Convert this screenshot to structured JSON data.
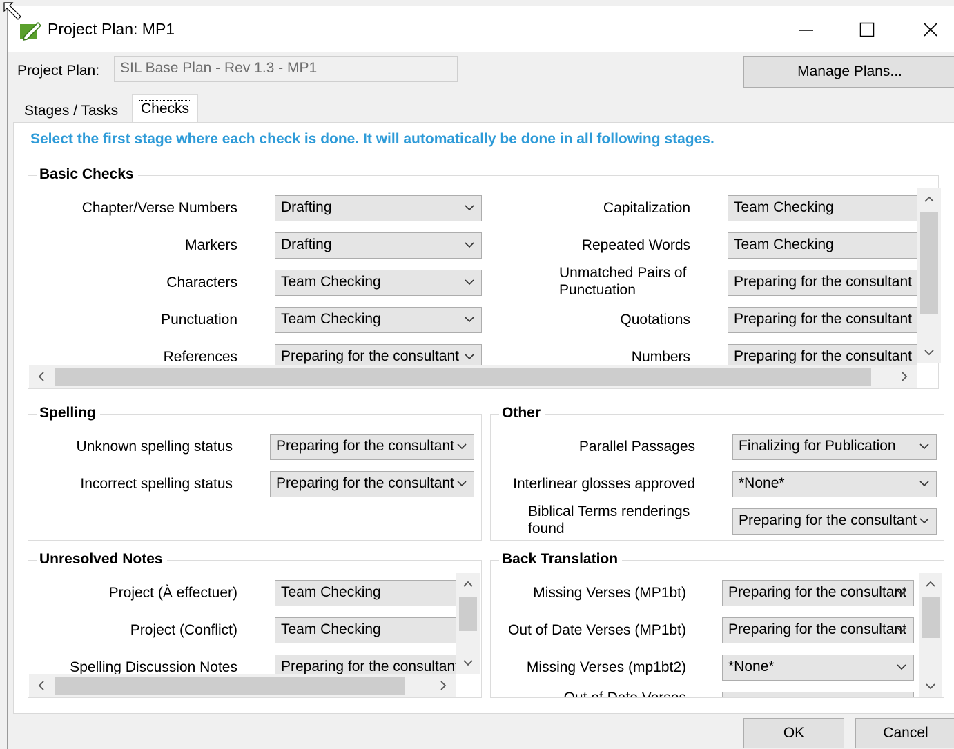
{
  "window": {
    "title": "Project Plan: MP1"
  },
  "project_plan": {
    "label": "Project Plan:",
    "value": "SIL Base Plan - Rev 1.3 - MP1",
    "manage_button": "Manage Plans..."
  },
  "tabs": [
    {
      "label": "Stages / Tasks"
    },
    {
      "label": "Checks"
    }
  ],
  "instruction": "Select the first stage where each check is done. It will automatically be done in all following stages.",
  "basic_checks": {
    "title": "Basic Checks",
    "left": [
      {
        "label": "Chapter/Verse Numbers",
        "value": "Drafting"
      },
      {
        "label": "Markers",
        "value": "Drafting"
      },
      {
        "label": "Characters",
        "value": "Team Checking"
      },
      {
        "label": "Punctuation",
        "value": "Team Checking"
      },
      {
        "label": "References",
        "value": "Preparing for the consultant"
      }
    ],
    "right": [
      {
        "label": "Capitalization",
        "value": "Team Checking"
      },
      {
        "label": "Repeated Words",
        "value": "Team Checking"
      },
      {
        "label": "Unmatched Pairs of Punctuation",
        "value": "Preparing for the consultant"
      },
      {
        "label": "Quotations",
        "value": "Preparing for the consultant"
      },
      {
        "label": "Numbers",
        "value": "Preparing for the consultant"
      }
    ]
  },
  "spelling": {
    "title": "Spelling",
    "rows": [
      {
        "label": "Unknown spelling status",
        "value": "Preparing for the consultant"
      },
      {
        "label": "Incorrect spelling status",
        "value": "Preparing for the consultant"
      }
    ]
  },
  "other": {
    "title": "Other",
    "rows": [
      {
        "label": "Parallel Passages",
        "value": "Finalizing for Publication"
      },
      {
        "label": "Interlinear glosses approved",
        "value": "*None*"
      },
      {
        "label": "Biblical Terms renderings found",
        "value": "Preparing for the consultant"
      }
    ]
  },
  "unresolved_notes": {
    "title": "Unresolved Notes",
    "rows": [
      {
        "label": "Project (À effectuer)",
        "value": "Team Checking"
      },
      {
        "label": "Project (Conflict)",
        "value": "Team Checking"
      },
      {
        "label": "Spelling Discussion Notes",
        "value": "Preparing for the consultant"
      }
    ]
  },
  "back_translation": {
    "title": "Back Translation",
    "rows": [
      {
        "label": "Missing Verses (MP1bt)",
        "value": "Preparing for the consultant"
      },
      {
        "label": "Out of Date Verses (MP1bt)",
        "value": "Preparing for the consultant"
      },
      {
        "label": "Missing Verses (mp1bt2)",
        "value": "*None*"
      },
      {
        "label": "Out of Date Verses",
        "value": ""
      }
    ]
  },
  "buttons": {
    "ok": "OK",
    "cancel": "Cancel"
  }
}
